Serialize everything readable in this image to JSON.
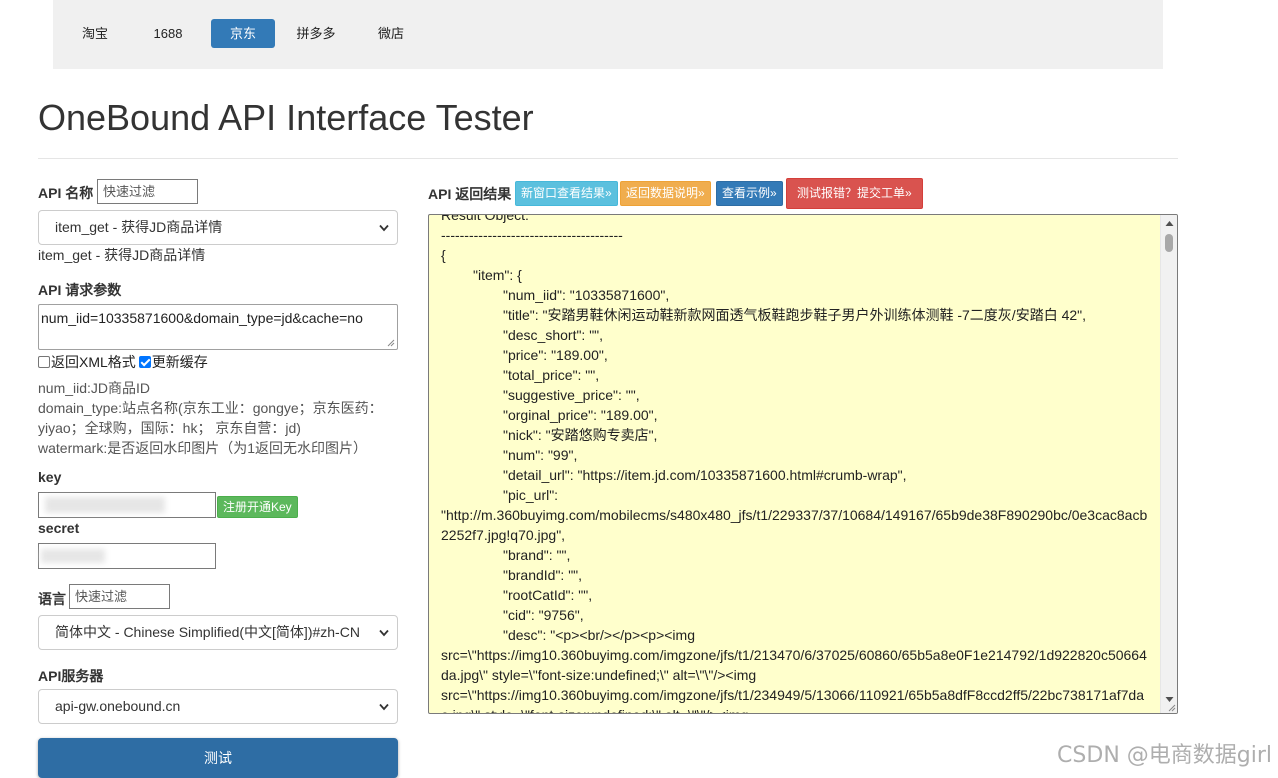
{
  "nav": {
    "tabs": [
      {
        "label": "淘宝",
        "active": false
      },
      {
        "label": "1688",
        "active": false
      },
      {
        "label": "京东",
        "active": true
      },
      {
        "label": "拼多多",
        "active": false
      },
      {
        "label": "微店",
        "active": false
      }
    ]
  },
  "page_title": "OneBound API Interface Tester",
  "api_name": {
    "label": "API 名称",
    "filter_placeholder": "快速过滤",
    "selected": "item_get - 获得JD商品详情",
    "description": "item_get - 获得JD商品详情"
  },
  "params": {
    "label": "API 请求参数",
    "value": "num_iid=10335871600&domain_type=jd&cache=no",
    "xml_checkbox": {
      "label": "返回XML格式",
      "checked": false
    },
    "cache_checkbox": {
      "label": "更新缓存",
      "checked": true
    },
    "help": [
      "num_iid:JD商品ID",
      "domain_type:站点名称(京东工业：gongye；京东医药：",
      "yiyao；全球购，国际：hk；  京东自营：jd)",
      "watermark:是否返回水印图片（为1返回无水印图片）"
    ]
  },
  "key": {
    "label": "key",
    "register_button": "注册开通Key"
  },
  "secret": {
    "label": "secret"
  },
  "language": {
    "label": "语言",
    "filter_placeholder": "快速过滤",
    "selected": "简体中文 - Chinese Simplified(中文[简体])#zh-CN"
  },
  "server": {
    "label": "API服务器",
    "selected": "api-gw.onebound.cn"
  },
  "test_button": "测试",
  "result": {
    "label": "API 返回结果",
    "buttons": {
      "new_window": "新窗口查看结果»",
      "data_desc": "返回数据说明»",
      "example": "查看示例»",
      "report": "测试报错？提交工单»"
    },
    "lines": [
      {
        "indent": 0,
        "text": "Result Object:"
      },
      {
        "indent": 0,
        "text": "---------------------------------------"
      },
      {
        "indent": 0,
        "text": "{"
      },
      {
        "indent": 1,
        "text": "\"item\": {"
      },
      {
        "indent": 2,
        "text": "\"num_iid\": \"10335871600\","
      },
      {
        "indent": 2,
        "text": "\"title\": \"安踏男鞋休闲运动鞋新款网面透气板鞋跑步鞋子男户外训练体测鞋 -7二度灰/安踏白 42\","
      },
      {
        "indent": 2,
        "text": "\"desc_short\": \"\","
      },
      {
        "indent": 2,
        "text": "\"price\": \"189.00\","
      },
      {
        "indent": 2,
        "text": "\"total_price\": \"\","
      },
      {
        "indent": 2,
        "text": "\"suggestive_price\": \"\","
      },
      {
        "indent": 2,
        "text": "\"orginal_price\": \"189.00\","
      },
      {
        "indent": 2,
        "text": "\"nick\": \"安踏悠购专卖店\","
      },
      {
        "indent": 2,
        "text": "\"num\": \"99\","
      },
      {
        "indent": 2,
        "text": "\"detail_url\": \"https://item.jd.com/10335871600.html#crumb-wrap\","
      },
      {
        "indent": 2,
        "text": "\"pic_url\":"
      },
      {
        "indent": 0,
        "text": "\"http://m.360buyimg.com/mobilecms/s480x480_jfs/t1/229337/37/10684/149167/65b9de38F890290bc/0e3cac8acb"
      },
      {
        "indent": 0,
        "text": "2252f7.jpg!q70.jpg\","
      },
      {
        "indent": 2,
        "text": "\"brand\": \"\","
      },
      {
        "indent": 2,
        "text": "\"brandId\": \"\","
      },
      {
        "indent": 2,
        "text": "\"rootCatId\": \"\","
      },
      {
        "indent": 2,
        "text": "\"cid\": \"9756\","
      },
      {
        "indent": 2,
        "text": "\"desc\": \"<p><br/></p><p><img"
      },
      {
        "indent": 0,
        "text": "src=\\\"https://img10.360buyimg.com/imgzone/jfs/t1/213470/6/37025/60860/65b5a8e0F1e214792/1d922820c50664"
      },
      {
        "indent": 0,
        "text": "da.jpg\\\" style=\\\"font-size:undefined;\\\" alt=\\\"\\\"/><img"
      },
      {
        "indent": 0,
        "text": "src=\\\"https://img10.360buyimg.com/imgzone/jfs/t1/234949/5/13066/110921/65b5a8dfF8ccd2ff5/22bc738171af7da"
      },
      {
        "indent": 0,
        "text": "e.jpg\\\" style=\\\"font-size:undefined;\\\" alt=\\\"\\\"/><img"
      }
    ]
  },
  "watermark": "CSDN @电商数据girl"
}
